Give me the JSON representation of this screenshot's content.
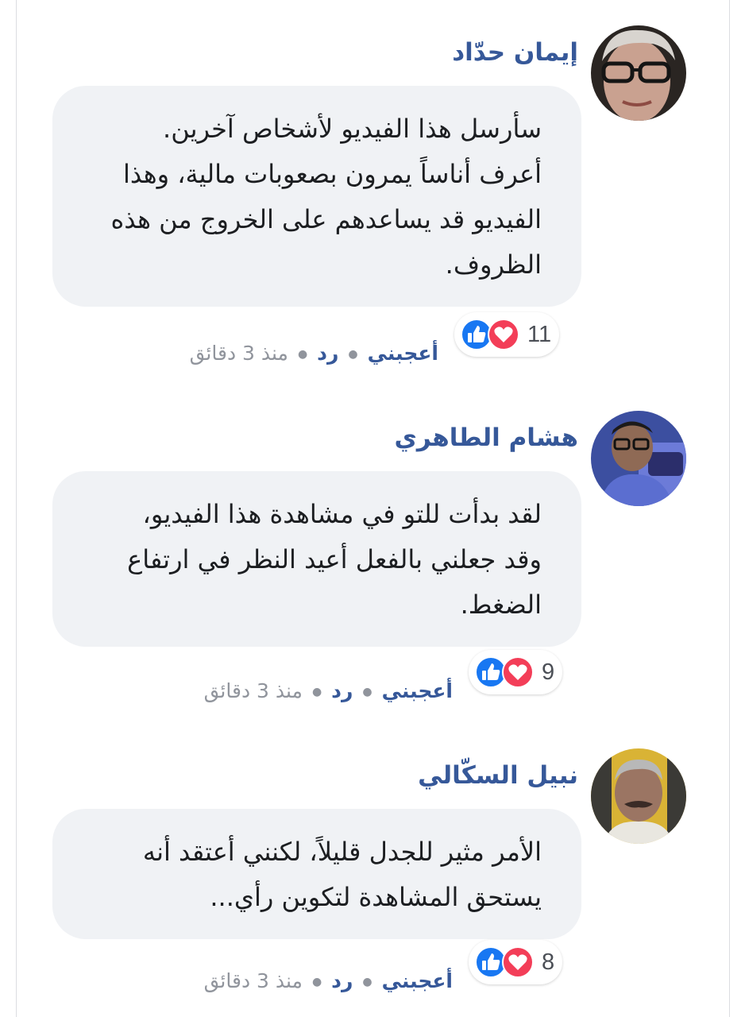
{
  "comments": [
    {
      "name": "إيمان حدّاد",
      "avatar_icon": "woman-with-glasses-avatar",
      "lines": [
        "سأرسل هذا الفيديو لأشخاص آخرين.",
        "أعرف أناساً يمرون بصعوبات مالية، وهذا",
        "الفيديو قد يساعدهم على الخروج من هذه",
        "الظروف."
      ],
      "reaction_count": "11",
      "like_label": "أعجبني",
      "reply_label": "رد",
      "time_label": "منذ 3 دقائق"
    },
    {
      "name": "هشام الطاهري",
      "avatar_icon": "man-with-glasses-avatar",
      "lines": [
        "لقد بدأت للتو في مشاهدة هذا الفيديو،",
        "وقد جعلني بالفعل أعيد النظر في ارتفاع",
        "الضغط."
      ],
      "reaction_count": "9",
      "like_label": "أعجبني",
      "reply_label": "رد",
      "time_label": "منذ 3 دقائق"
    },
    {
      "name": "نبيل السكّالي",
      "avatar_icon": "man-with-mustache-avatar",
      "lines": [
        "الأمر مثير للجدل قليلاً، لكنني أعتقد أنه",
        "يستحق المشاهدة لتكوين رأي..."
      ],
      "reaction_count": "8",
      "like_label": "أعجبني",
      "reply_label": "رد",
      "time_label": "منذ 3 دقائق"
    }
  ],
  "reaction_icons": [
    "like-icon",
    "love-icon"
  ],
  "colors": {
    "name": "#365899",
    "bubble": "#f0f2f5",
    "like_blue": "#1877f2",
    "love_red": "#f33e58",
    "meta_gray": "#90949c"
  }
}
